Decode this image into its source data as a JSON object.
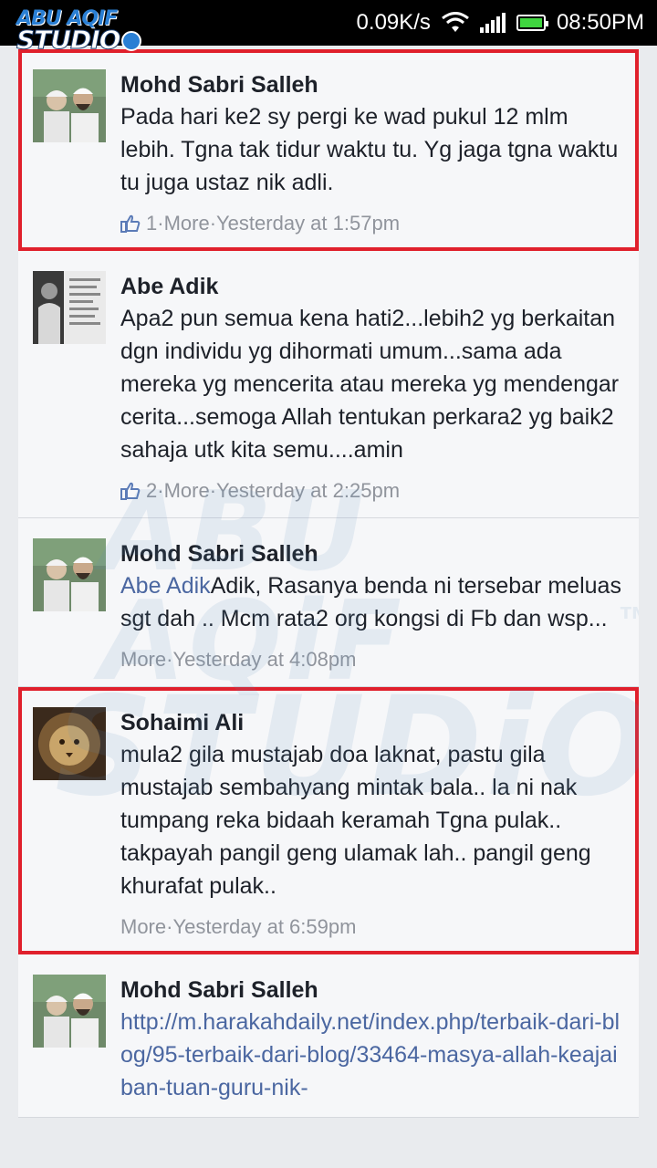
{
  "status_bar": {
    "logo_line1": "ABU AQIF",
    "logo_line2": "STUDIO",
    "network_speed": "0.09K/s",
    "time": "08:50PM"
  },
  "watermark": {
    "line1": "ABU AQiF",
    "line2": "STUDiO",
    "tm": "TM"
  },
  "comments": [
    {
      "author": "Mohd Sabri Salleh",
      "text": "Pada hari ke2 sy pergi ke wad pukul 12 mlm lebih. Tgna tak tidur waktu tu. Yg jaga tgna waktu tu juga ustaz nik adli.",
      "likes": "1",
      "more": "More",
      "time": "Yesterday at 1:57pm",
      "highlighted": true
    },
    {
      "author": "Abe Adik",
      "text": "Apa2 pun semua kena hati2...lebih2 yg berkaitan dgn individu yg dihormati umum...sama ada mereka yg mencerita atau mereka yg mendengar cerita...semoga Allah tentukan perkara2 yg baik2 sahaja utk kita semu....amin",
      "likes": "2",
      "more": "More",
      "time": "Yesterday at 2:25pm",
      "highlighted": false
    },
    {
      "author": "Mohd Sabri Salleh",
      "mention": "Abe Adik",
      "text": "Adik, Rasanya benda ni tersebar meluas sgt dah .. Mcm rata2 org kongsi di Fb dan wsp...",
      "more": "More",
      "time": "Yesterday at 4:08pm",
      "highlighted": false
    },
    {
      "author": "Sohaimi Ali",
      "text": "mula2 gila mustajab doa laknat, pastu gila mustajab sembahyang mintak bala.. la ni nak tumpang reka bidaah keramah Tgna pulak.. takpayah pangil geng ulamak lah.. pangil geng khurafat pulak..",
      "more": "More",
      "time": "Yesterday at 6:59pm",
      "highlighted": true
    },
    {
      "author": "Mohd Sabri Salleh",
      "link": "http://m.harakahdaily.net/index.php/terbaik-dari-blog/95-terbaik-dari-blog/33464-masya-allah-keajaiban-tuan-guru-nik-",
      "highlighted": false
    }
  ],
  "meta_separator": " · "
}
